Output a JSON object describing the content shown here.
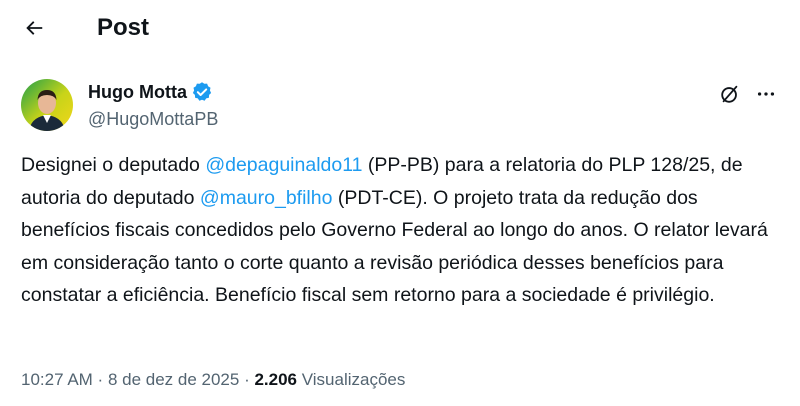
{
  "header": {
    "title": "Post"
  },
  "author": {
    "name": "Hugo Motta",
    "handle": "@HugoMottaPB",
    "verified_color": "#1d9bf0"
  },
  "post": {
    "segments": [
      {
        "text": "Designei o deputado ",
        "kind": "text"
      },
      {
        "text": "@depaguinaldo11",
        "kind": "mention"
      },
      {
        "text": " (PP-PB) para a relatoria do PLP 128/25, de autoria do deputado ",
        "kind": "text"
      },
      {
        "text": "@mauro_bfilho",
        "kind": "mention"
      },
      {
        "text": " (PDT-CE). O projeto trata da redução dos benefícios fiscais concedidos pelo Governo Federal ao longo do anos. O relator levará em consideração tanto o corte quanto a revisão periódica desses benefícios para constatar a eficiência. Benefício fiscal sem retorno para a sociedade é privilégio.",
        "kind": "text"
      }
    ],
    "time": "10:27 AM",
    "separator": " · ",
    "date": "8 de dez de 2025",
    "views_count": "2.206",
    "views_label": "Visualizações"
  },
  "icons": {
    "back": "back-arrow-icon",
    "verified": "verified-badge-icon",
    "grok": "grok-icon",
    "more": "more-icon"
  },
  "colors": {
    "accent": "#1d9bf0",
    "text": "#0f1419",
    "muted": "#536471"
  }
}
